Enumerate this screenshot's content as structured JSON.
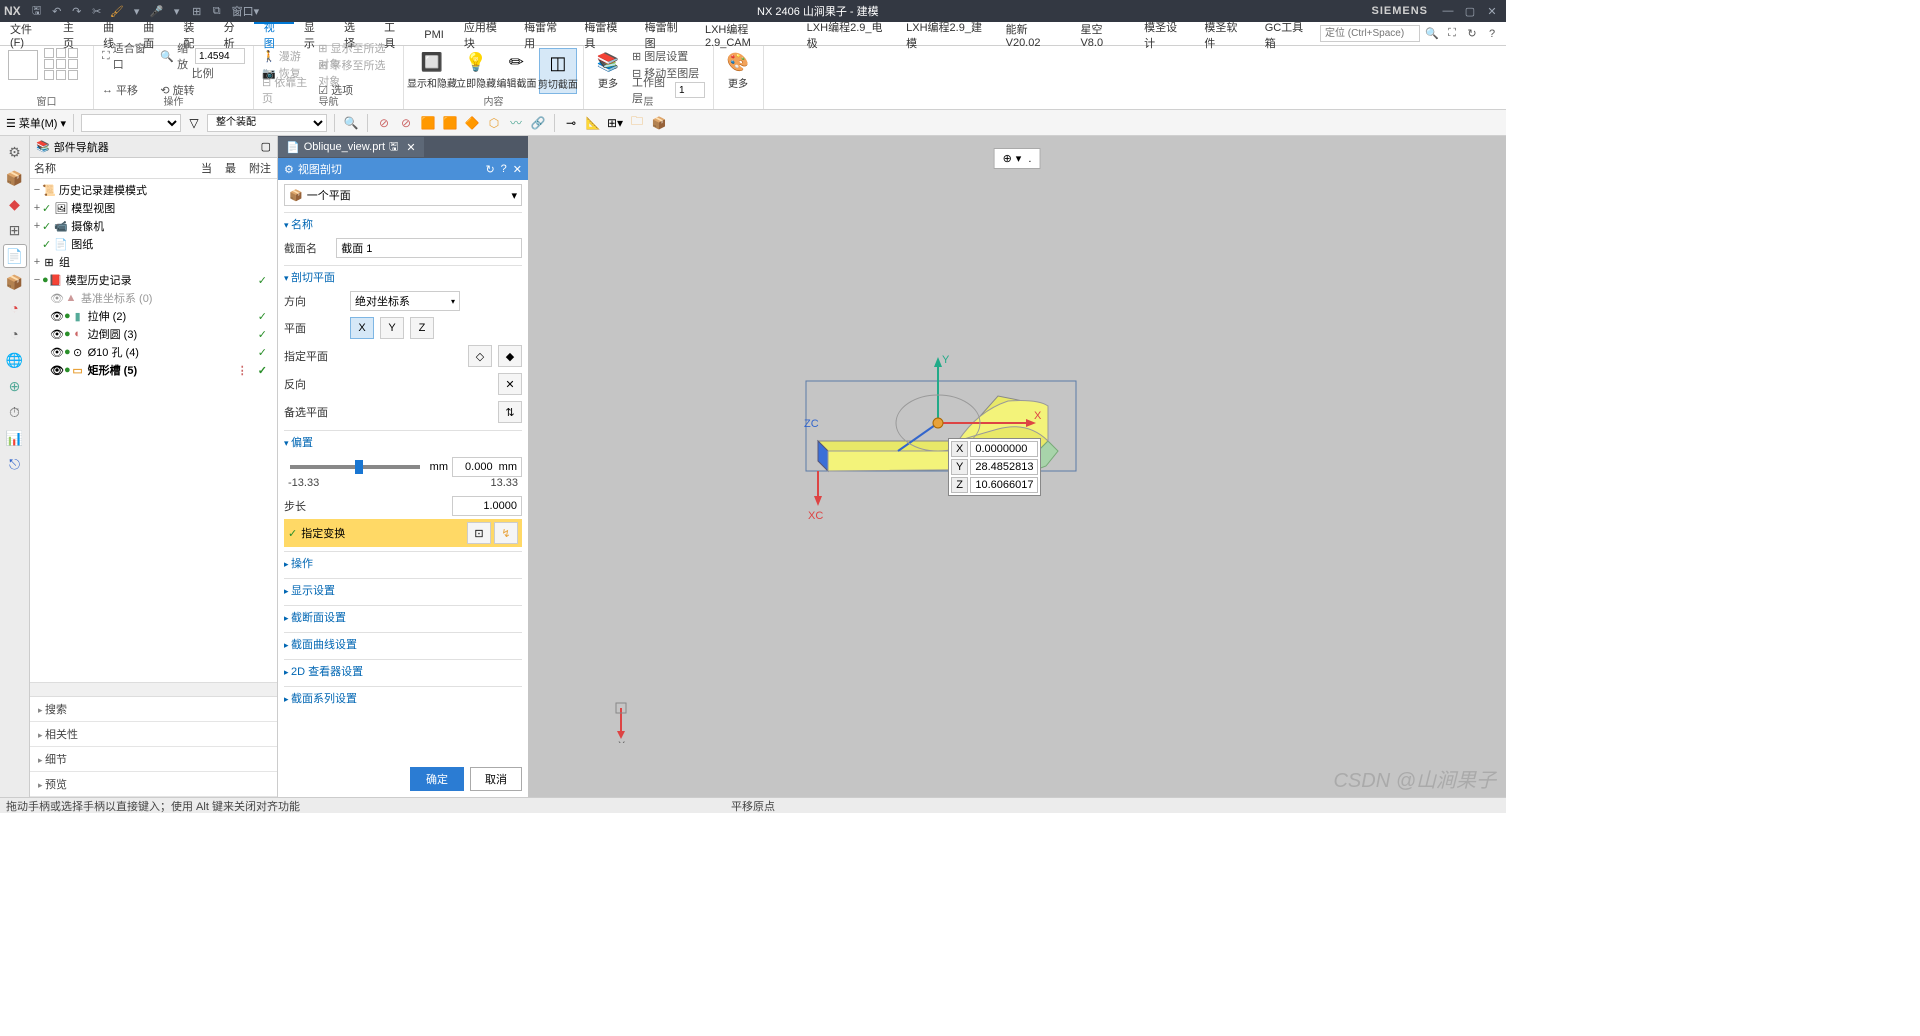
{
  "app": {
    "nx": "NX",
    "title": "NX 2406 山涧果子 - 建模",
    "brand": "SIEMENS"
  },
  "quick": [
    "🖫",
    "↶",
    "↷",
    "✂",
    "🖇",
    "📋",
    "▾",
    "🎤",
    "▾",
    "⊞",
    "⧉",
    "窗口",
    "▾"
  ],
  "menu": {
    "items": [
      "文件(F)",
      "主页",
      "曲线",
      "曲面",
      "装配",
      "分析",
      "视图",
      "显示",
      "选择",
      "工具",
      "PMI",
      "应用模块",
      "梅雷常用",
      "梅雷模具",
      "梅雷制图",
      "LXH编程2.9_CAM",
      "LXH编程2.9_电极",
      "LXH编程2.9_建模",
      "能新 V20.02",
      "星空 V8.0",
      "模圣设计",
      "模圣软件",
      "GC工具箱"
    ],
    "active": 6,
    "search_ph": "定位 (Ctrl+Space)"
  },
  "ribbon": {
    "groups": [
      {
        "label": "窗口",
        "type": "big_grid"
      },
      {
        "label": "操作",
        "items": [
          {
            "t": "small",
            "ico": "⛶",
            "txt": "适合窗口"
          },
          {
            "t": "small",
            "ico": "↔",
            "txt": "平移"
          }
        ],
        "col2": [
          {
            "ico": "🔍",
            "txt": "缩放",
            "val": "1.4594"
          },
          {
            "txt": "比例"
          },
          {
            "ico": "⟲",
            "txt": "旋转"
          }
        ]
      },
      {
        "label": "导航",
        "dis_items": [
          "🚶 漫游",
          "📷 恢复",
          "⊞ 显示至所选对象",
          "⊞ 平移至所选对象",
          "⊟ 依靠主页"
        ],
        "extra": "☑ 选项"
      },
      {
        "label": "内容",
        "btns": [
          {
            "ico": "🔲",
            "txt": "显示和隐藏"
          },
          {
            "ico": "💡",
            "txt": "立即隐藏"
          },
          {
            "ico": "✏",
            "txt": "编辑截面"
          },
          {
            "ico": "◫",
            "txt": "剪切截面",
            "active": true
          }
        ]
      },
      {
        "label": "层",
        "btns": [
          {
            "ico": "📚",
            "txt": "更多"
          }
        ],
        "rows": [
          {
            "ico": "⊞",
            "txt": "图层设置"
          },
          {
            "ico": "⊟",
            "txt": "移动至图层"
          },
          {
            "txt": "工作图层",
            "val": "1"
          }
        ]
      },
      {
        "label": "",
        "btns": [
          {
            "ico": "🎨",
            "txt": "更多"
          }
        ]
      }
    ]
  },
  "toolbar2": {
    "menu": "菜单(M)",
    "sel1": "",
    "sel2": "整个装配",
    "icons": [
      "🔍",
      "⊘",
      "⊘",
      "🟧",
      "🟧",
      "🔶",
      "⬡",
      "〰",
      "🔗",
      "⊸",
      "📐",
      "⊞",
      "▾",
      "🗀",
      "📦"
    ]
  },
  "leftbar": {
    "icons": [
      "⚙",
      "📦",
      "📦",
      "⊞",
      "📄",
      "📦",
      "📦",
      "◔",
      "🔲",
      "⊕",
      "⏱",
      "📊",
      "⎋"
    ],
    "active": 4
  },
  "panel": {
    "title": "部件导航器",
    "cols": [
      "名称",
      "当",
      "最",
      "附注"
    ],
    "nodes": [
      {
        "ind": 0,
        "tgl": "−",
        "ico": "📜",
        "txt": "历史记录建模模式"
      },
      {
        "ind": 0,
        "tgl": "+",
        "chk": true,
        "ico": "📷",
        "txt": "模型视图"
      },
      {
        "ind": 0,
        "tgl": "+",
        "chk": true,
        "ico": "📹",
        "txt": "摄像机"
      },
      {
        "ind": 0,
        "tgl": "",
        "chk": true,
        "ico": "📄",
        "txt": "图纸"
      },
      {
        "ind": 0,
        "tgl": "+",
        "ico": "⊞",
        "txt": "组"
      },
      {
        "ind": 0,
        "tgl": "−",
        "grn": true,
        "ico": "📕",
        "txt": "模型历史记录",
        "st": "✓"
      },
      {
        "ind": 1,
        "eye": "👁",
        "dim": true,
        "ico": "▲",
        "txt": "基准坐标系 (0)"
      },
      {
        "ind": 1,
        "eye": "👁",
        "grn": true,
        "ico": "🟩",
        "txt": "拉伸 (2)",
        "st": "✓"
      },
      {
        "ind": 1,
        "eye": "👁",
        "grn": true,
        "ico": "◐",
        "txt": "边倒圆 (3)",
        "st": "✓"
      },
      {
        "ind": 1,
        "eye": "👁",
        "grn": true,
        "ico": "⊙",
        "txt": "Ø10 孔 (4)",
        "st": "✓"
      },
      {
        "ind": 1,
        "eye": "👁",
        "grn": true,
        "bold": true,
        "ico": "▭",
        "txt": "矩形槽 (5)",
        "st2": "⋮",
        "st": "✓"
      }
    ],
    "acc": [
      "搜索",
      "相关性",
      "细节",
      "预览"
    ]
  },
  "dialog": {
    "tab": "Oblique_view.prt",
    "tab_mod": "🖫",
    "title": "视图剖切",
    "plane_sel": "一个平面",
    "sections": {
      "name": {
        "hdr": "名称",
        "lbl": "截面名",
        "val": "截面 1"
      },
      "cut": {
        "hdr": "剖切平面",
        "dir_lbl": "方向",
        "dir_val": "绝对坐标系",
        "plane_lbl": "平面",
        "spec_lbl": "指定平面",
        "rev_lbl": "反向",
        "alt_lbl": "备选平面"
      },
      "offset": {
        "hdr": "偏置",
        "unit": "mm",
        "val": "0.000  mm",
        "min": "-13.33",
        "max": "13.33",
        "step_lbl": "步长",
        "step_val": "1.0000",
        "trans": "指定变换"
      },
      "collapsed": [
        "操作",
        "显示设置",
        "截断面设置",
        "截面曲线设置",
        "2D 查看器设置",
        "截面系列设置"
      ]
    },
    "ok": "确定",
    "cancel": "取消"
  },
  "coords": {
    "X": "0.0000000",
    "Y": "28.4852813",
    "Z": "10.6066017"
  },
  "status": {
    "left": "拖动手柄或选择手柄以直接键入；使用 Alt 键来关闭对齐功能",
    "center": "平移原点"
  },
  "watermark": "CSDN @山涧果子"
}
